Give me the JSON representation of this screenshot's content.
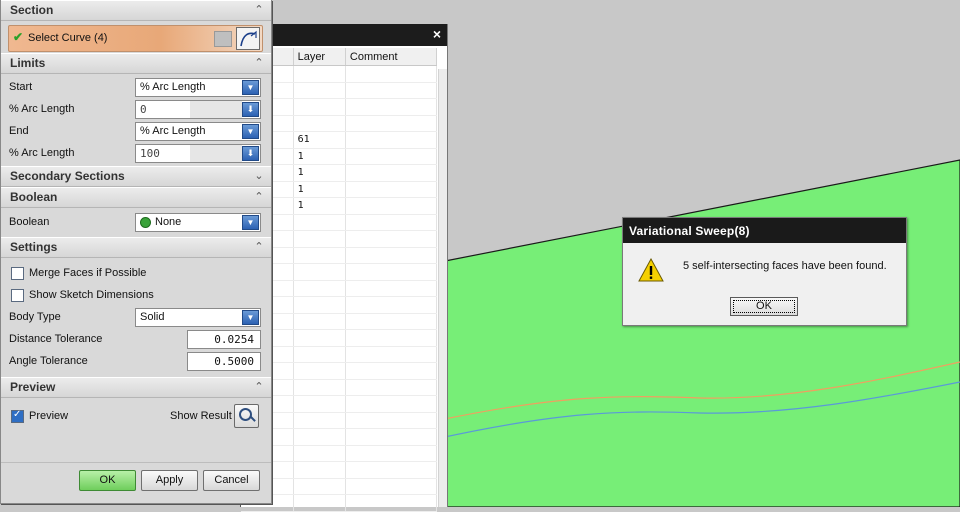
{
  "navigator": {
    "columns": [
      "tamp",
      "Layer",
      "Comment"
    ],
    "rows": [
      [
        "",
        "",
        ""
      ],
      [
        "",
        "",
        ""
      ],
      [
        "",
        "",
        ""
      ],
      [
        "",
        "",
        ""
      ],
      [
        "",
        "61",
        ""
      ],
      [
        "",
        "1",
        ""
      ],
      [
        "",
        "1",
        ""
      ],
      [
        "",
        "1",
        ""
      ],
      [
        "",
        "1",
        ""
      ],
      [
        "",
        "",
        ""
      ],
      [
        "",
        "",
        ""
      ],
      [
        "",
        "",
        ""
      ],
      [
        "",
        "",
        ""
      ],
      [
        "",
        "",
        ""
      ],
      [
        "",
        "",
        ""
      ],
      [
        "",
        "",
        ""
      ],
      [
        "",
        "",
        ""
      ],
      [
        "",
        "",
        ""
      ],
      [
        "",
        "",
        ""
      ],
      [
        "",
        "",
        ""
      ],
      [
        "",
        "",
        ""
      ],
      [
        "",
        "",
        ""
      ],
      [
        "",
        "",
        ""
      ],
      [
        "",
        "",
        ""
      ],
      [
        "",
        "",
        ""
      ],
      [
        "",
        "",
        ""
      ],
      [
        "",
        "",
        ""
      ]
    ],
    "close_glyph": "×"
  },
  "dialog": {
    "section": {
      "title": "Section",
      "select_curve": "Select Curve (4)"
    },
    "limits": {
      "title": "Limits",
      "start_label": "Start",
      "start_value": "% Arc Length",
      "start_arc_label": "% Arc Length",
      "start_arc_value": "0",
      "end_label": "End",
      "end_value": "% Arc Length",
      "end_arc_label": "% Arc Length",
      "end_arc_value": "100"
    },
    "secondary": {
      "title": "Secondary Sections"
    },
    "boolean": {
      "title": "Boolean",
      "label": "Boolean",
      "value": "None"
    },
    "settings": {
      "title": "Settings",
      "merge_faces": "Merge Faces if Possible",
      "show_sketch": "Show Sketch Dimensions",
      "body_type_label": "Body Type",
      "body_type_value": "Solid",
      "dist_tol_label": "Distance Tolerance",
      "dist_tol_value": "0.0254",
      "angle_tol_label": "Angle Tolerance",
      "angle_tol_value": "0.5000"
    },
    "preview": {
      "title": "Preview",
      "preview_label": "Preview",
      "show_result": "Show Result"
    },
    "buttons": {
      "ok": "OK",
      "apply": "Apply",
      "cancel": "Cancel"
    }
  },
  "message": {
    "title": "Variational Sweep(8)",
    "text": "5 self-intersecting faces have been found.",
    "ok": "OK"
  },
  "colors": {
    "viewport_bg": "#c8c8c8",
    "green_face": "#77ee77",
    "orange_curve": "#f0a060",
    "blue_curve": "#5a9ad8",
    "select_curve_bg": "#e8a878"
  }
}
